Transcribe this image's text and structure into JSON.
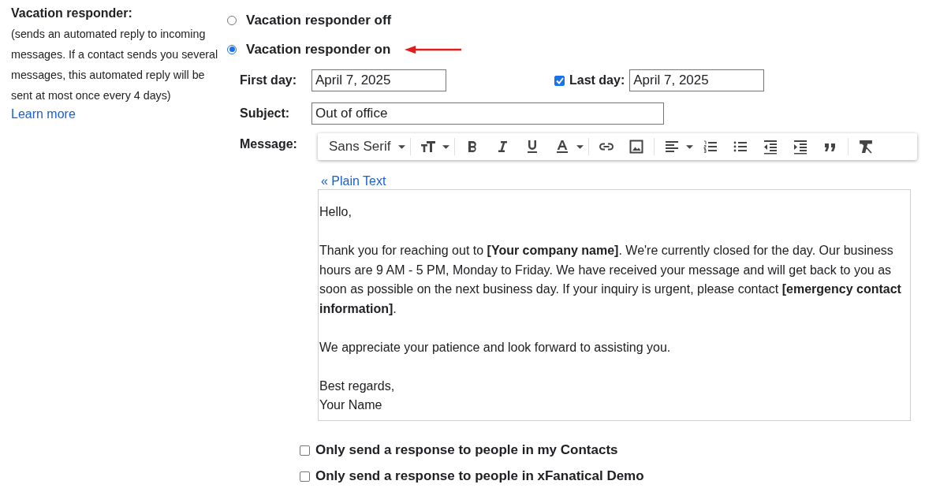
{
  "responder": {
    "title": "Vacation responder:",
    "description": "(sends an automated reply to incoming messages. If a contact sends you several messages, this automated reply will be sent at most once every 4 days)",
    "learn_more": "Learn more"
  },
  "options": [
    {
      "label": "Vacation responder off",
      "selected": false
    },
    {
      "label": "Vacation responder on",
      "selected": true
    }
  ],
  "first_day": {
    "label": "First day:",
    "value": "April 7, 2025"
  },
  "last_day": {
    "label": "Last day:",
    "checked": true,
    "value": "April 7, 2025"
  },
  "subject": {
    "label": "Subject:",
    "value": "Out of office"
  },
  "message": {
    "label": "Message:",
    "font": "Sans Serif",
    "plain_text_link": "« Plain Text",
    "body": [
      {
        "lines": [
          "Hello,"
        ]
      },
      {
        "lines": [
          "Thank you for reaching out to **[Your company name]**. We're currently closed for the day. Our business hours are 9 AM - 5 PM, Monday to Friday. We have received your message and will get back to you as soon as possible on the next business day. If your inquiry is urgent, please contact **[emergency contact information]**."
        ]
      },
      {
        "lines": [
          "We appreciate your patience and look forward to assisting you."
        ]
      },
      {
        "lines": [
          "Best regards,",
          "Your Name"
        ]
      }
    ]
  },
  "restrictions": [
    {
      "label": "Only send a response to people in my Contacts",
      "checked": false
    },
    {
      "label": "Only send a response to people in xFanatical Demo",
      "checked": false
    }
  ]
}
